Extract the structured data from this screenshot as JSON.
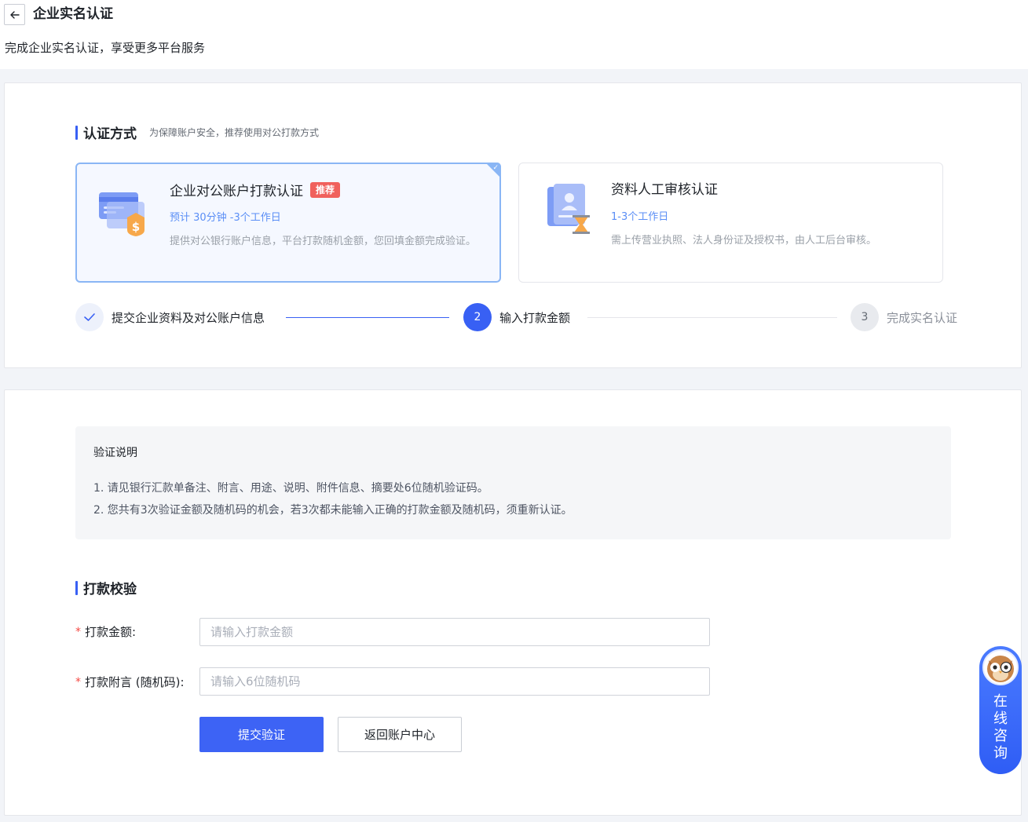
{
  "header": {
    "title": "企业实名认证",
    "subtitle": "完成企业实名认证，享受更多平台服务"
  },
  "auth_section": {
    "title": "认证方式",
    "hint": "为保障账户安全，推荐使用对公打款方式"
  },
  "methods": [
    {
      "title": "企业对公账户打款认证",
      "badge": "推荐",
      "time": "预计 30分钟 -3个工作日",
      "desc": "提供对公银行账户信息，平台打款随机金额，您回填金额完成验证。",
      "selected": true
    },
    {
      "title": "资料人工审核认证",
      "time": "1-3个工作日",
      "desc": "需上传营业执照、法人身份证及授权书，由人工后台审核。",
      "selected": false
    }
  ],
  "steps": [
    {
      "index": "✓",
      "label": "提交企业资料及对公账户信息",
      "status": "done"
    },
    {
      "index": "2",
      "label": "输入打款金额",
      "status": "active"
    },
    {
      "index": "3",
      "label": "完成实名认证",
      "status": "pending"
    }
  ],
  "notice": {
    "title": "验证说明",
    "lines": [
      "1. 请见银行汇款单备注、附言、用途、说明、附件信息、摘要处6位随机验证码。",
      "2. 您共有3次验证金额及随机码的机会，若3次都未能输入正确的打款金额及随机码，须重新认证。"
    ]
  },
  "verify_section": {
    "title": "打款校验"
  },
  "form": {
    "amount_label": "打款金额:",
    "amount_placeholder": "请输入打款金额",
    "code_label": "打款附言 (随机码):",
    "code_placeholder": "请输入6位随机码",
    "required_mark": "*"
  },
  "buttons": {
    "submit": "提交验证",
    "back": "返回账户中心"
  },
  "consult": {
    "label": "在线咨询"
  },
  "colors": {
    "primary": "#3860f4",
    "selected_border": "#8ab6f5",
    "badge": "#f0615c",
    "time_text": "#5a8ef6"
  }
}
